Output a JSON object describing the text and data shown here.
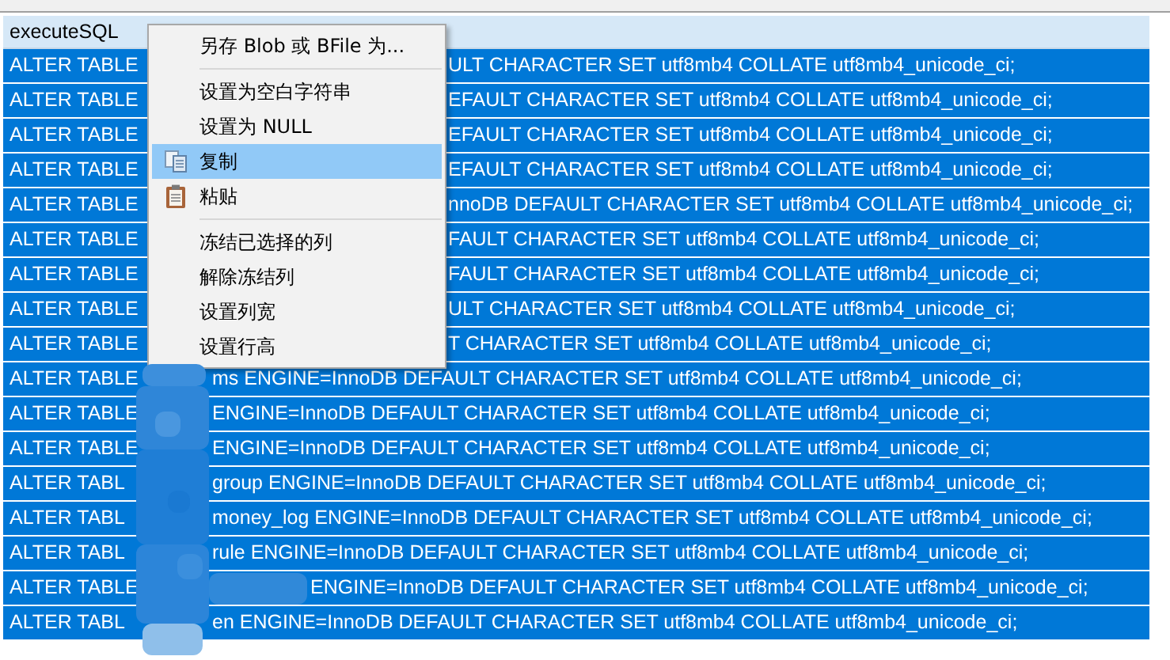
{
  "table": {
    "columns": [
      {
        "label": "executeSQL"
      }
    ],
    "rows": [
      {
        "kind": "menu",
        "selected": true,
        "left": "ALTER TABLE",
        "right": "ULT CHARACTER SET utf8mb4 COLLATE utf8mb4_unicode_ci;"
      },
      {
        "kind": "menu",
        "selected": true,
        "left": "ALTER TABLE",
        "right": "EFAULT CHARACTER SET utf8mb4 COLLATE utf8mb4_unicode_ci;"
      },
      {
        "kind": "menu",
        "selected": true,
        "left": "ALTER TABLE",
        "right": "EFAULT CHARACTER SET utf8mb4 COLLATE utf8mb4_unicode_ci;"
      },
      {
        "kind": "menu",
        "selected": true,
        "left": "ALTER TABLE",
        "right": "EFAULT CHARACTER SET utf8mb4 COLLATE utf8mb4_unicode_ci;"
      },
      {
        "kind": "menu",
        "selected": true,
        "left": "ALTER TABLE",
        "right": "nnoDB DEFAULT CHARACTER SET utf8mb4 COLLATE utf8mb4_unicode_ci;"
      },
      {
        "kind": "menu",
        "selected": true,
        "left": "ALTER TABLE",
        "right": "FAULT CHARACTER SET utf8mb4 COLLATE utf8mb4_unicode_ci;"
      },
      {
        "kind": "menu",
        "selected": true,
        "left": "ALTER TABLE",
        "right": "FAULT CHARACTER SET utf8mb4 COLLATE utf8mb4_unicode_ci;"
      },
      {
        "kind": "menu",
        "selected": true,
        "left": "ALTER TABLE",
        "right": "ULT CHARACTER SET utf8mb4 COLLATE utf8mb4_unicode_ci;"
      },
      {
        "kind": "menu",
        "selected": true,
        "left": "ALTER TABLE",
        "right": "T CHARACTER SET utf8mb4 COLLATE utf8mb4_unicode_ci;"
      },
      {
        "kind": "mosaic",
        "selected": true,
        "left": "ALTER TABLE",
        "right": "ms ENGINE=InnoDB DEFAULT CHARACTER SET utf8mb4 COLLATE utf8mb4_unicode_ci;"
      },
      {
        "kind": "mosaic",
        "selected": true,
        "left": "ALTER TABLE",
        "right": "ENGINE=InnoDB DEFAULT CHARACTER SET utf8mb4 COLLATE utf8mb4_unicode_ci;"
      },
      {
        "kind": "mosaic",
        "selected": true,
        "left": "ALTER TABLE",
        "right": "ENGINE=InnoDB DEFAULT CHARACTER SET utf8mb4 COLLATE utf8mb4_unicode_ci;"
      },
      {
        "kind": "mosaic",
        "selected": true,
        "left": "ALTER TABL",
        "right": "group ENGINE=InnoDB DEFAULT CHARACTER SET utf8mb4 COLLATE utf8mb4_unicode_ci;"
      },
      {
        "kind": "mosaic",
        "selected": true,
        "left": "ALTER TABL",
        "right": "money_log ENGINE=InnoDB DEFAULT CHARACTER SET utf8mb4 COLLATE utf8mb4_unicode_ci;"
      },
      {
        "kind": "mosaic",
        "selected": true,
        "left": "ALTER TABL",
        "right": "rule ENGINE=InnoDB DEFAULT CHARACTER SET utf8mb4 COLLATE utf8mb4_unicode_ci;"
      },
      {
        "kind": "mosaic_wide",
        "selected": true,
        "left": "ALTER TABLE",
        "right": "ENGINE=InnoDB DEFAULT CHARACTER SET utf8mb4 COLLATE utf8mb4_unicode_ci;"
      },
      {
        "kind": "mosaic",
        "selected": true,
        "left": "ALTER TABL",
        "right": "en ENGINE=InnoDB DEFAULT CHARACTER SET utf8mb4 COLLATE utf8mb4_unicode_ci;"
      }
    ]
  },
  "context_menu": {
    "items": [
      {
        "kind": "item",
        "label": "另存 Blob 或 BFile 为...",
        "selected": false
      },
      {
        "kind": "separator"
      },
      {
        "kind": "item",
        "label": "设置为空白字符串",
        "selected": false
      },
      {
        "kind": "item",
        "label": "设置为 NULL",
        "selected": false
      },
      {
        "kind": "copy",
        "label": "复制",
        "selected": true
      },
      {
        "kind": "paste",
        "label": "粘贴",
        "selected": false
      },
      {
        "kind": "separator"
      },
      {
        "kind": "item",
        "label": "冻结已选择的列",
        "selected": false
      },
      {
        "kind": "item",
        "label": "解除冻结列",
        "selected": false
      },
      {
        "kind": "item",
        "label": "设置列宽",
        "selected": false
      },
      {
        "kind": "item",
        "label": "设置行高",
        "selected": false
      }
    ]
  }
}
